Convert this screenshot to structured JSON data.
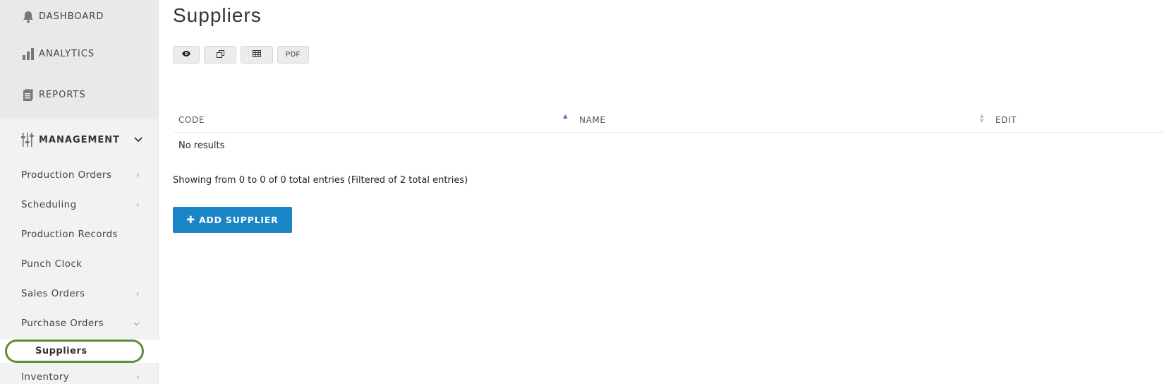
{
  "sidebar": {
    "top_items": [
      {
        "label": "DASHBOARD",
        "icon": "bell-icon"
      },
      {
        "label": "ANALYTICS",
        "icon": "bar-chart-icon"
      },
      {
        "label": "REPORTS",
        "icon": "document-icon"
      }
    ],
    "section": {
      "label": "MANAGEMENT",
      "icon": "sliders-icon",
      "expanded": true
    },
    "items": [
      {
        "label": "Production Orders",
        "has_arrow": true
      },
      {
        "label": "Scheduling",
        "has_arrow": true
      },
      {
        "label": "Production Records",
        "has_arrow": false
      },
      {
        "label": "Punch Clock",
        "has_arrow": false
      },
      {
        "label": "Sales Orders",
        "has_arrow": true
      },
      {
        "label": "Purchase Orders",
        "has_arrow": true,
        "expanded": true
      }
    ],
    "active_sub_item": {
      "label": "Suppliers"
    },
    "after_items": [
      {
        "label": "Inventory",
        "has_arrow": true
      }
    ]
  },
  "page": {
    "title": "Suppliers"
  },
  "toolbar": {
    "view_icon": "eye-icon",
    "copy_icon": "copy-icon",
    "excel_icon": "table-icon",
    "pdf_label": "PDF"
  },
  "table": {
    "columns": [
      {
        "label": "CODE",
        "sort": "asc"
      },
      {
        "label": "NAME",
        "sort": "none"
      },
      {
        "label": "EDIT"
      }
    ],
    "empty_text": "No results"
  },
  "footer": {
    "showing_text": "Showing from 0 to 0 of 0 total entries (Filtered of 2 total entries)"
  },
  "actions": {
    "add_label": "ADD SUPPLIER"
  },
  "colors": {
    "accent": "#1a86c8",
    "active_outline": "#5a8f3a",
    "sort_active": "#6a5acd"
  }
}
